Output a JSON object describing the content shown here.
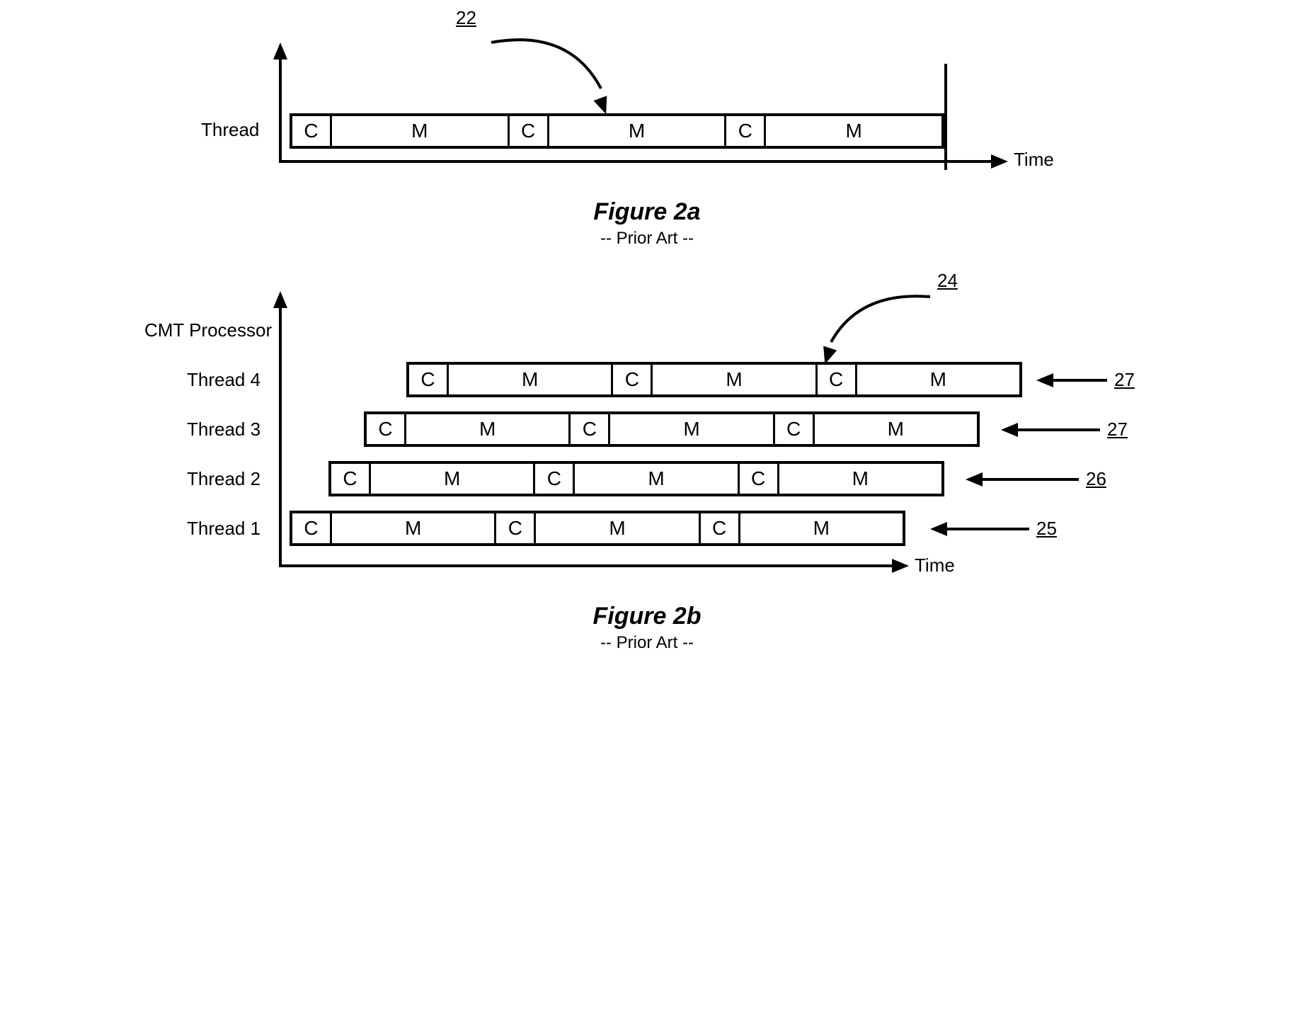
{
  "figA": {
    "title": "Figure 2a",
    "subtitle": "-- Prior Art --",
    "ref": "22",
    "yLabel": "Thread",
    "xLabel": "Time",
    "segs": [
      "C",
      "M",
      "C",
      "M",
      "C",
      "M"
    ]
  },
  "figB": {
    "title": "Figure 2b",
    "subtitle": "-- Prior Art --",
    "ref": "24",
    "header": "CMT Processor",
    "xLabel": "Time",
    "threads": [
      {
        "label": "Thread 4",
        "ref": "27",
        "segs": [
          "C",
          "M",
          "C",
          "M",
          "C",
          "M"
        ]
      },
      {
        "label": "Thread 3",
        "ref": "27",
        "segs": [
          "C",
          "M",
          "C",
          "M",
          "C",
          "M"
        ]
      },
      {
        "label": "Thread 2",
        "ref": "26",
        "segs": [
          "C",
          "M",
          "C",
          "M",
          "C",
          "M"
        ]
      },
      {
        "label": "Thread 1",
        "ref": "25",
        "segs": [
          "C",
          "M",
          "C",
          "M",
          "C",
          "M"
        ]
      }
    ]
  }
}
